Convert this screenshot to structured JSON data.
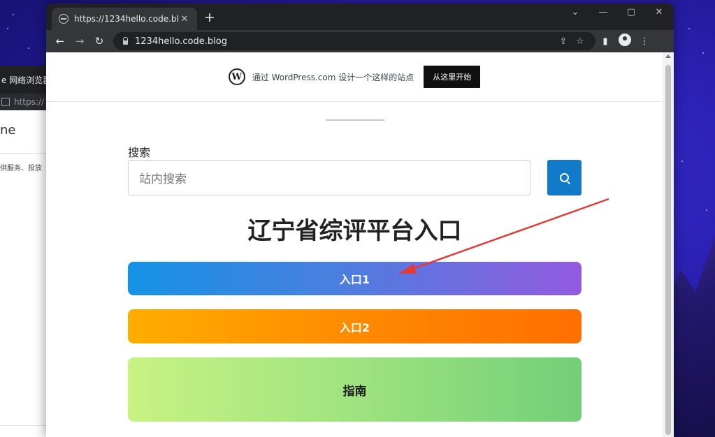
{
  "background_window": {
    "tab_label": "e 网络浏览器",
    "url": "https://",
    "heading": "ne",
    "text": "供服务、投放"
  },
  "browser": {
    "tab_title": "https://1234hello.code.blog",
    "tab_close": "✕",
    "new_tab": "+",
    "window_controls": {
      "minimize": "—",
      "restore": "▢",
      "close": "✕",
      "dropdown": "⌄"
    },
    "nav": {
      "back": "←",
      "forward": "→",
      "reload": "↻"
    },
    "address": "1234hello.code.blog",
    "icons": {
      "share": "⇪",
      "star": "☆",
      "sidepanel": "▮",
      "menu": "⋮"
    }
  },
  "wp_banner": {
    "logo": "W",
    "text": "通过 WordPress.com 设计一个这样的站点",
    "cta": "从这里开始"
  },
  "search": {
    "label": "搜索",
    "placeholder": "站内搜索"
  },
  "main": {
    "title": "辽宁省综评平台入口",
    "entry1": "入口1",
    "entry2": "入口2",
    "guide": "指南"
  },
  "colors": {
    "accent_blue": "#117ac9",
    "annotation_arrow": "#e53935"
  }
}
